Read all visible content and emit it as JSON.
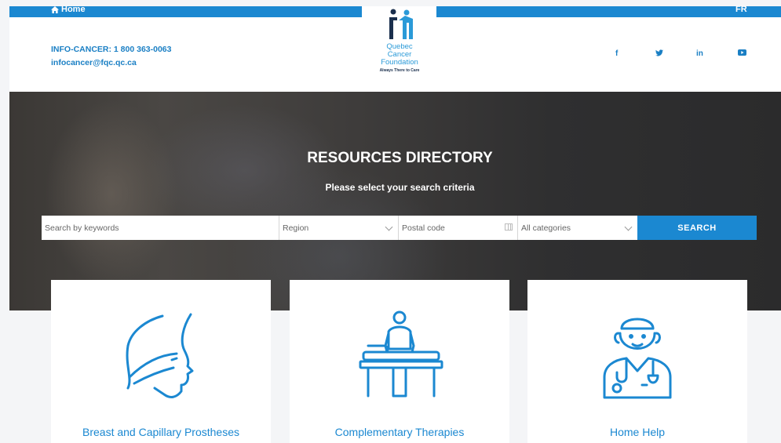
{
  "topbar": {
    "home_label": "Home",
    "lang_label": "FR"
  },
  "contact": {
    "phone_line": "INFO-CANCER: 1 800 363-0063",
    "email": "infocancer@fqc.qc.ca"
  },
  "logo": {
    "line1": "Quebec",
    "line2": "Cancer",
    "line3": "Foundation",
    "tagline": "Always There to Care"
  },
  "social": {
    "facebook": "f",
    "linkedin": "in"
  },
  "hero": {
    "title": "RESOURCES DIRECTORY",
    "subtitle": "Please select your search criteria"
  },
  "search": {
    "keywords_placeholder": "Search by keywords",
    "region_value": "Region",
    "postal_placeholder": "Postal code",
    "category_value": "All categories",
    "button_label": "SEARCH"
  },
  "cards": [
    {
      "label": "Breast and Capillary Prostheses",
      "icon": "breast-profile-icon"
    },
    {
      "label": "Complementary Therapies",
      "icon": "massage-table-icon"
    },
    {
      "label": "Home Help",
      "icon": "nurse-icon"
    }
  ],
  "colors": {
    "accent": "#1b88d1",
    "dark": "#1a2f4d",
    "background": "#f4f5f7"
  }
}
